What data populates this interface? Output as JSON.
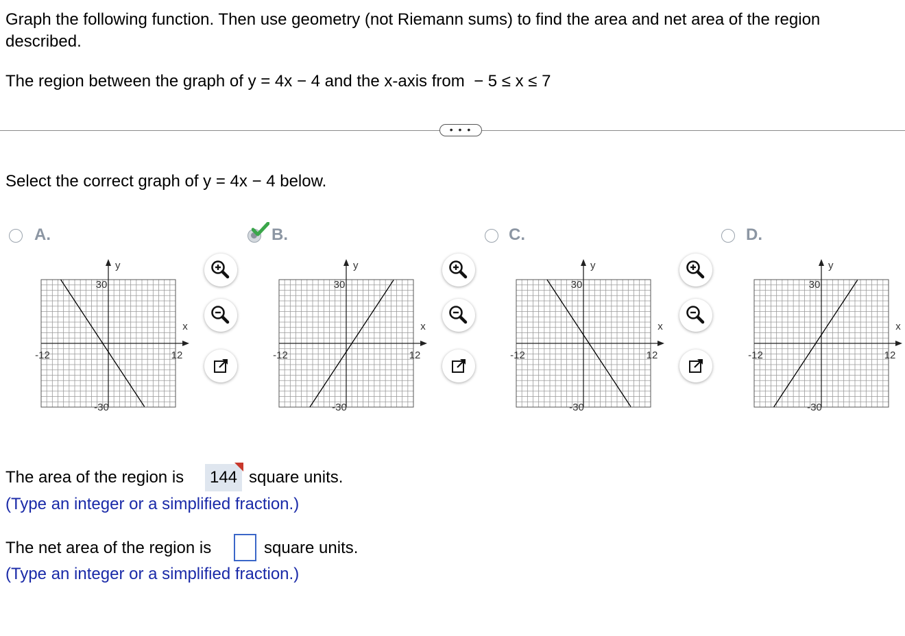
{
  "question": {
    "line1": "Graph the following function. Then use geometry (not Riemann sums) to find the area and net area of the region",
    "line2": "described.",
    "region": "The region between the graph of y = 4x − 4 and the x-axis from  − 5 ≤ x ≤ 7"
  },
  "more_button_label": "• • •",
  "select_prompt": "Select the correct graph of y = 4x − 4 below.",
  "options": [
    {
      "letter": "A.",
      "selected": false,
      "correct": false
    },
    {
      "letter": "B.",
      "selected": true,
      "correct": true
    },
    {
      "letter": "C.",
      "selected": false,
      "correct": false
    },
    {
      "letter": "D.",
      "selected": false,
      "correct": false
    }
  ],
  "graph_labels": {
    "x_axis": "x",
    "y_axis": "y",
    "x_min": "-12",
    "x_max": "12",
    "y_max": "30",
    "y_min": "-30"
  },
  "tools": [
    "zoom-in-icon",
    "zoom-out-icon",
    "open-in-new-window-icon"
  ],
  "area": {
    "prefix": "The area of the region is",
    "value": "144",
    "suffix": "square units.",
    "hint": "(Type an integer or a simplified fraction.)"
  },
  "net_area": {
    "prefix": "The net area of the region is",
    "value": "",
    "suffix": "square units.",
    "hint": "(Type an integer or a simplified fraction.)"
  },
  "colors": {
    "hint_blue": "#1a2aa8",
    "checkmark_green": "#3aa64a",
    "input_border": "#3a66c8",
    "answer_bg": "#dfe6ef",
    "flag_red": "#c8382b"
  }
}
